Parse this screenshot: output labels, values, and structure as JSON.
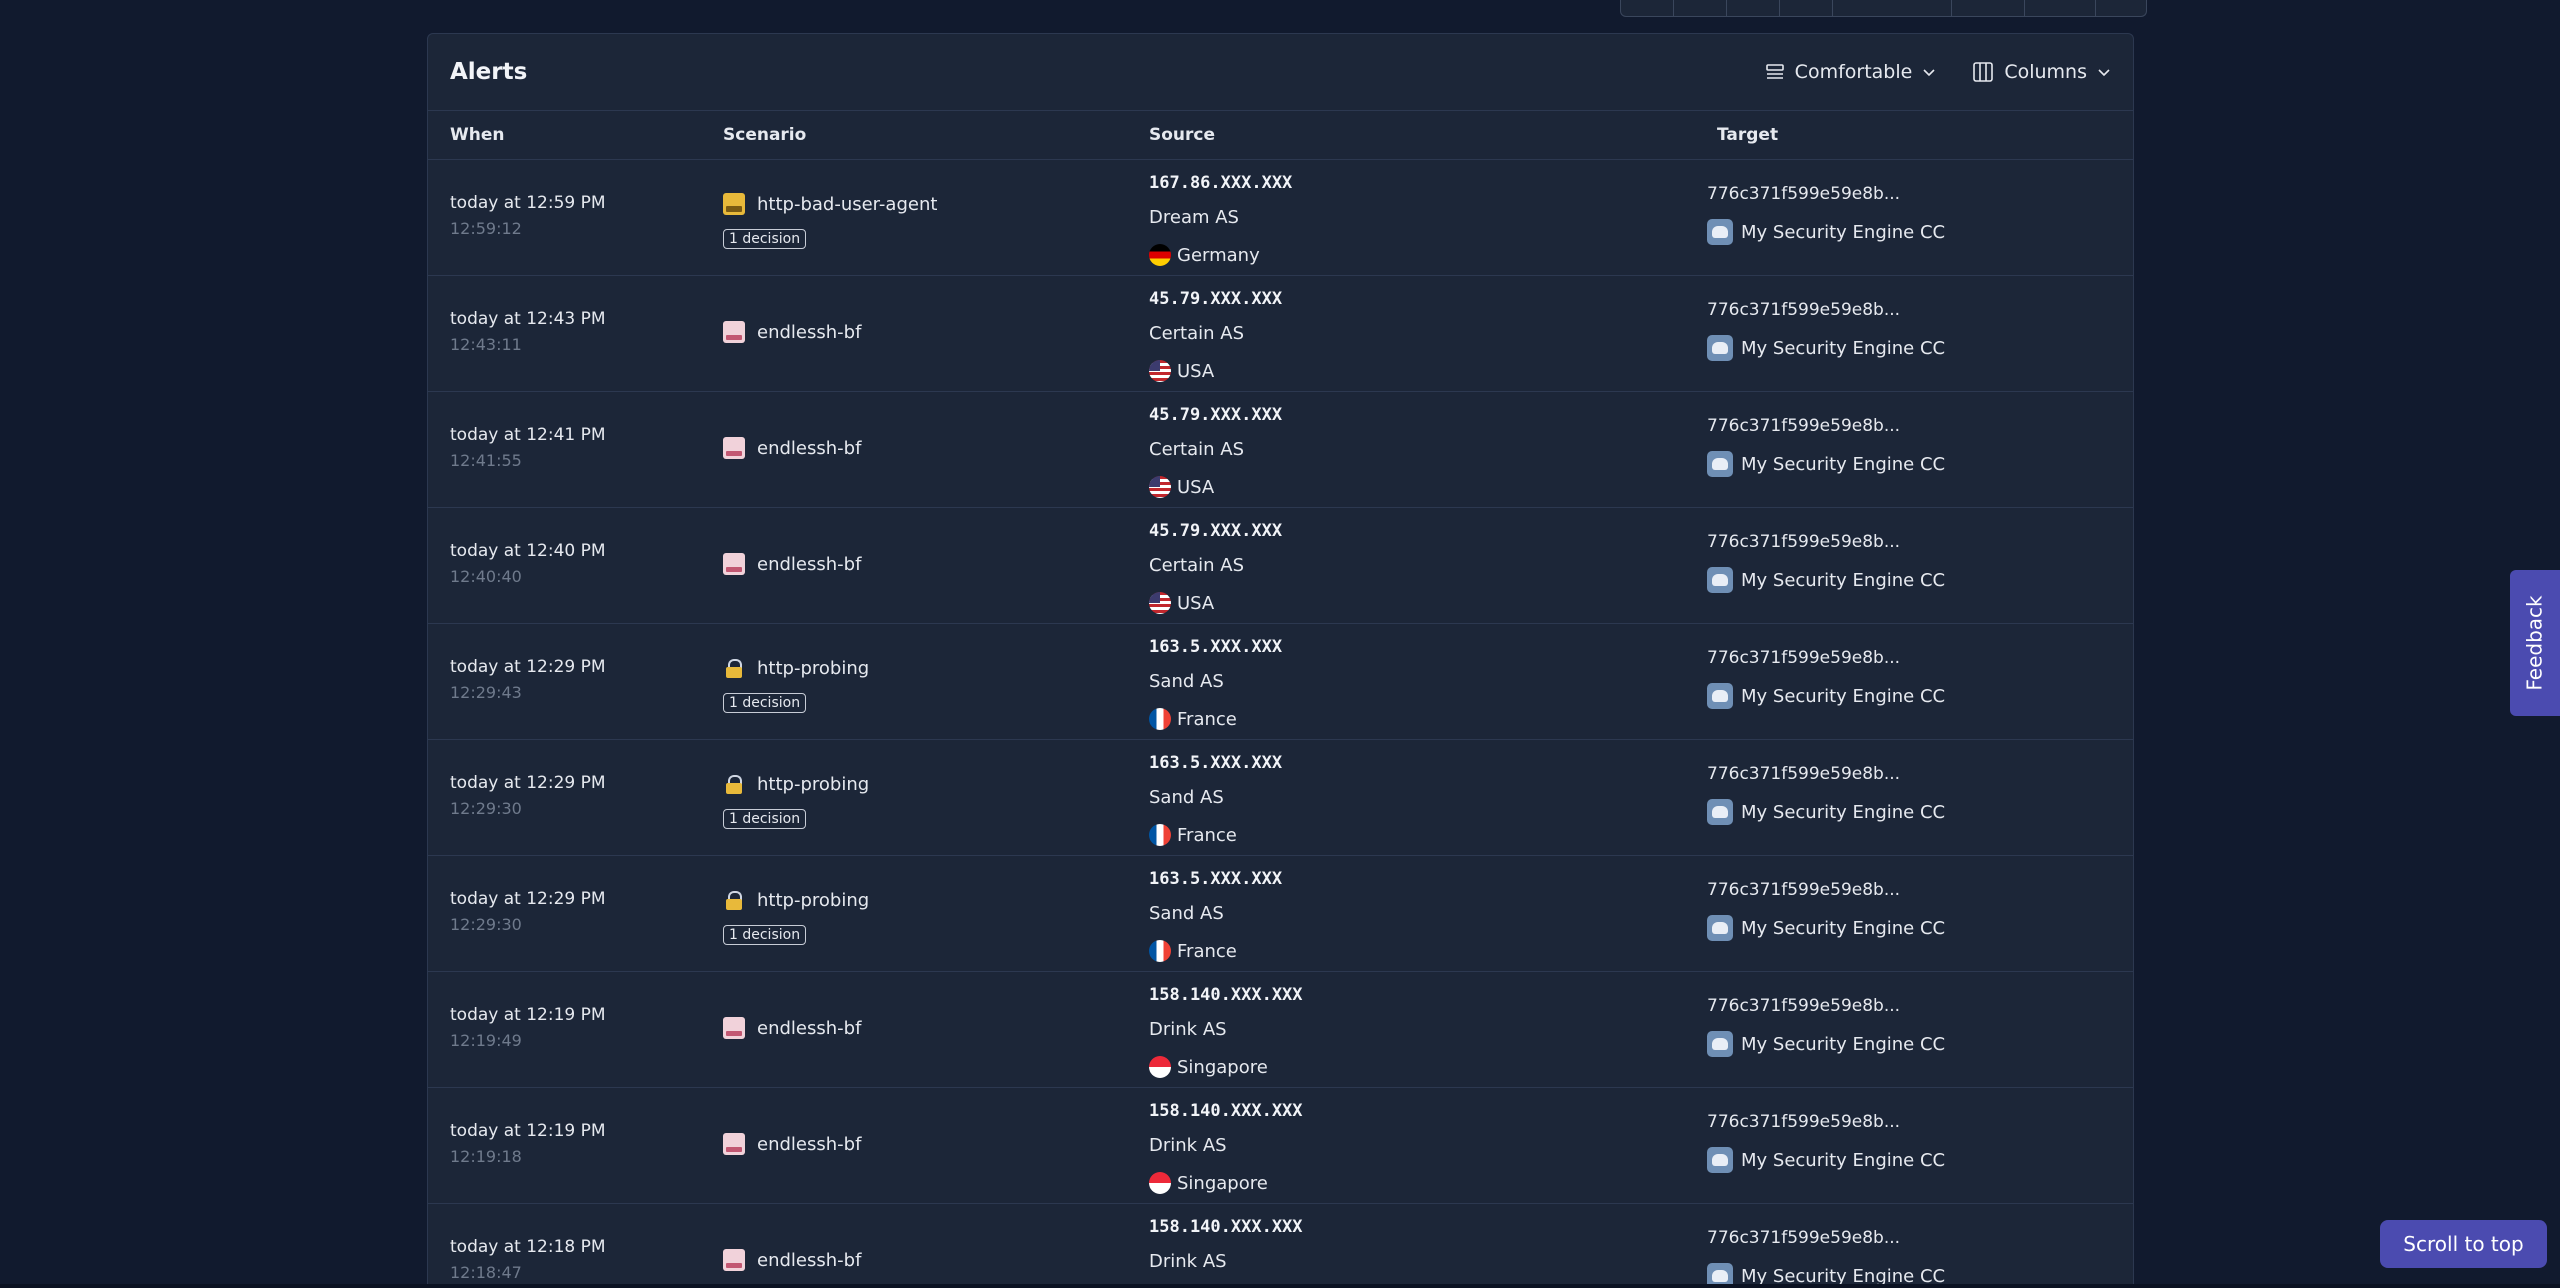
{
  "card": {
    "title": "Alerts",
    "density_label": "Comfortable",
    "columns_label": "Columns"
  },
  "table": {
    "headers": {
      "when": "When",
      "scenario": "Scenario",
      "source": "Source",
      "target": "Target"
    },
    "rows": [
      {
        "when": "today at 12:59 PM",
        "time": "12:59:12",
        "scenario": "http-bad-user-agent",
        "icon": "bad-user-agent-icon",
        "decision": "1 decision",
        "ip": "167.86.XXX.XXX",
        "as": "Dream AS",
        "country": "Germany",
        "flag": "de",
        "target_id": "776c371f599e59e8b...",
        "engine": "My Security Engine CC"
      },
      {
        "when": "today at 12:43 PM",
        "time": "12:43:11",
        "scenario": "endlessh-bf",
        "icon": "ssh-terminal-icon",
        "decision": "",
        "ip": "45.79.XXX.XXX",
        "as": "Certain AS",
        "country": "USA",
        "flag": "us",
        "target_id": "776c371f599e59e8b...",
        "engine": "My Security Engine CC"
      },
      {
        "when": "today at 12:41 PM",
        "time": "12:41:55",
        "scenario": "endlessh-bf",
        "icon": "ssh-terminal-icon",
        "decision": "",
        "ip": "45.79.XXX.XXX",
        "as": "Certain AS",
        "country": "USA",
        "flag": "us",
        "target_id": "776c371f599e59e8b...",
        "engine": "My Security Engine CC"
      },
      {
        "when": "today at 12:40 PM",
        "time": "12:40:40",
        "scenario": "endlessh-bf",
        "icon": "ssh-terminal-icon",
        "decision": "",
        "ip": "45.79.XXX.XXX",
        "as": "Certain AS",
        "country": "USA",
        "flag": "us",
        "target_id": "776c371f599e59e8b...",
        "engine": "My Security Engine CC"
      },
      {
        "when": "today at 12:29 PM",
        "time": "12:29:43",
        "scenario": "http-probing",
        "icon": "lock-icon",
        "decision": "1 decision",
        "ip": "163.5.XXX.XXX",
        "as": "Sand AS",
        "country": "France",
        "flag": "fr",
        "target_id": "776c371f599e59e8b...",
        "engine": "My Security Engine CC"
      },
      {
        "when": "today at 12:29 PM",
        "time": "12:29:30",
        "scenario": "http-probing",
        "icon": "lock-icon",
        "decision": "1 decision",
        "ip": "163.5.XXX.XXX",
        "as": "Sand AS",
        "country": "France",
        "flag": "fr",
        "target_id": "776c371f599e59e8b...",
        "engine": "My Security Engine CC"
      },
      {
        "when": "today at 12:29 PM",
        "time": "12:29:30",
        "scenario": "http-probing",
        "icon": "lock-icon",
        "decision": "1 decision",
        "ip": "163.5.XXX.XXX",
        "as": "Sand AS",
        "country": "France",
        "flag": "fr",
        "target_id": "776c371f599e59e8b...",
        "engine": "My Security Engine CC"
      },
      {
        "when": "today at 12:19 PM",
        "time": "12:19:49",
        "scenario": "endlessh-bf",
        "icon": "ssh-terminal-icon",
        "decision": "",
        "ip": "158.140.XXX.XXX",
        "as": "Drink AS",
        "country": "Singapore",
        "flag": "sg",
        "target_id": "776c371f599e59e8b...",
        "engine": "My Security Engine CC"
      },
      {
        "when": "today at 12:19 PM",
        "time": "12:19:18",
        "scenario": "endlessh-bf",
        "icon": "ssh-terminal-icon",
        "decision": "",
        "ip": "158.140.XXX.XXX",
        "as": "Drink AS",
        "country": "Singapore",
        "flag": "sg",
        "target_id": "776c371f599e59e8b...",
        "engine": "My Security Engine CC"
      },
      {
        "when": "today at 12:18 PM",
        "time": "12:18:47",
        "scenario": "endlessh-bf",
        "icon": "ssh-terminal-icon",
        "decision": "",
        "ip": "158.140.XXX.XXX",
        "as": "Drink AS",
        "country": "",
        "flag": "sg",
        "target_id": "776c371f599e59e8b...",
        "engine": "My Security Engine CC"
      }
    ]
  },
  "feedback_label": "Feedback",
  "scroll_top_label": "Scroll to top",
  "colors": {
    "background": "#111a2e",
    "card": "#1c2638",
    "accent": "#4b4bb0"
  }
}
